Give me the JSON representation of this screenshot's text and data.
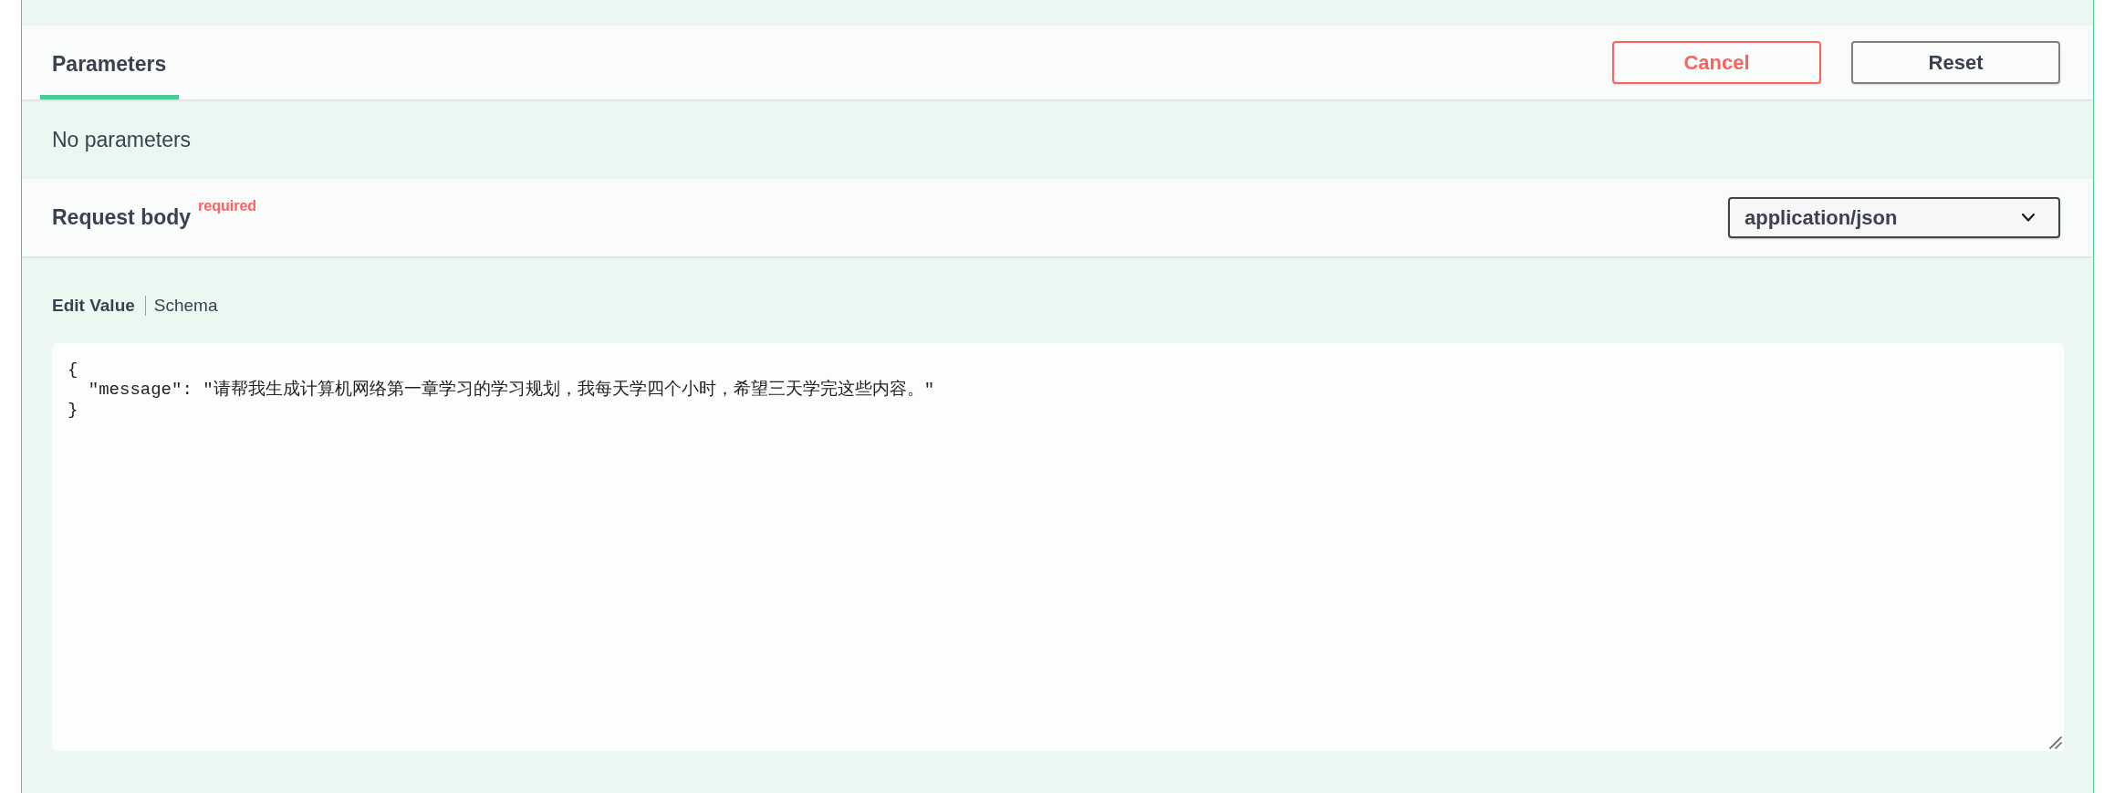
{
  "parameters": {
    "tabs": [
      {
        "label": "Parameters",
        "selected": true
      }
    ],
    "buttons": [
      {
        "label": "Cancel",
        "kind": "cancel"
      },
      {
        "label": "Reset",
        "kind": "reset"
      }
    ],
    "empty_message": "No parameters"
  },
  "request_body": {
    "title": "Request body",
    "required_label": "required",
    "content_type": "application/json",
    "tabs": [
      {
        "label": "Edit Value",
        "selected": true
      },
      {
        "label": "Schema",
        "selected": false
      }
    ],
    "value": "{\n  \"message\": \"请帮我生成计算机网络第一章学习的学习规划，我每天学四个小时，希望三天学完这些内容。\"\n}"
  }
}
